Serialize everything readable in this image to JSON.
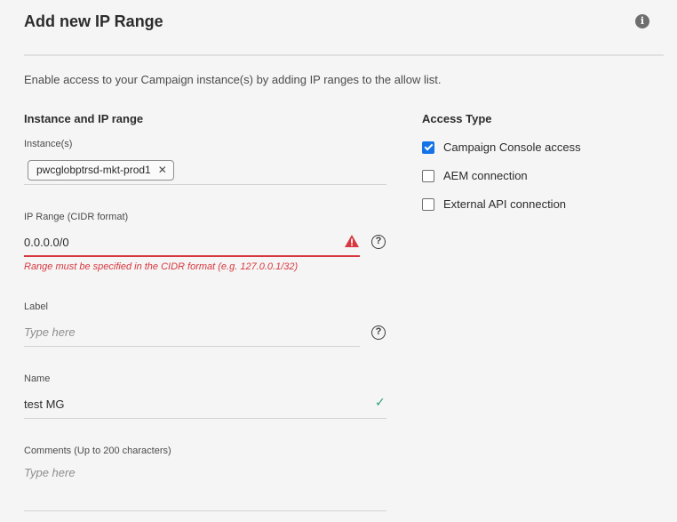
{
  "header": {
    "title": "Add new IP Range",
    "info_icon": "i"
  },
  "description": "Enable access to your Campaign instance(s) by adding IP ranges to the allow list.",
  "instance_section": {
    "heading": "Instance and IP range",
    "instances_label": "Instance(s)",
    "instance_tag": "pwcglobptrsd-mkt-prod1",
    "tag_remove_glyph": "✕"
  },
  "ip_range": {
    "label": "IP Range (CIDR format)",
    "value": "0.0.0.0/0",
    "error": "Range must be specified in the CIDR format (e.g. 127.0.0.1/32)",
    "error_color": "#d7373f",
    "help_glyph": "?"
  },
  "label_field": {
    "label": "Label",
    "placeholder": "Type here",
    "help_glyph": "?"
  },
  "name_field": {
    "label": "Name",
    "value": "test MG",
    "valid_glyph": "✓",
    "valid_color": "#2d9d78"
  },
  "comments_field": {
    "label": "Comments (Up to 200 characters)",
    "placeholder": "Type here"
  },
  "access_type": {
    "heading": "Access Type",
    "options": [
      {
        "label": "Campaign Console access",
        "checked": true
      },
      {
        "label": "AEM connection",
        "checked": false
      },
      {
        "label": "External API connection",
        "checked": false
      }
    ],
    "accent_color": "#1473e6"
  }
}
